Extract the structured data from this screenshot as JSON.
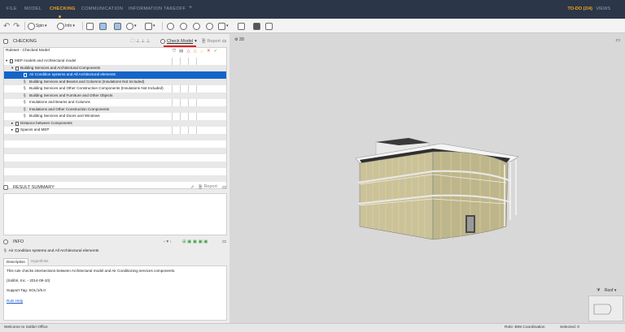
{
  "topbar": {
    "tabs": [
      "FILE",
      "MODEL",
      "CHECKING",
      "COMMUNICATION",
      "INFORMATION TAKEOFF"
    ],
    "active_tab": "CHECKING",
    "todo": "TO-DO (2/4)",
    "views": "VIEWS"
  },
  "toolbar": {
    "spin_label": "Spin",
    "info_label": "Info",
    "search_placeholder": "Search"
  },
  "checking": {
    "title": "CHECKING",
    "check_model_label": "Check Model",
    "report_label": "Report",
    "ruleset": "Ruleset - Checked Model",
    "tree": [
      {
        "label": "MEP models and Architectural model",
        "level": 0
      },
      {
        "label": "Building Services and Architectural Components",
        "level": 1
      },
      {
        "label": "Air Condition systems and All Architectural elements",
        "level": 2
      },
      {
        "label": "Building Services and Beams and Columns (Insulations Not Included)",
        "level": 2
      },
      {
        "label": "Building Services and Other Construction Components (Insulations Not Included)",
        "level": 2
      },
      {
        "label": "Building Services and Furniture and Other Objects",
        "level": 2
      },
      {
        "label": "Insulations and Beams and Columns",
        "level": 2
      },
      {
        "label": "Insulations and Other Construction Components",
        "level": 2
      },
      {
        "label": "Building Services and Doors and Windows",
        "level": 2
      },
      {
        "label": "Distance between Components",
        "level": 1
      },
      {
        "label": "Spaces and MEP",
        "level": 1
      }
    ]
  },
  "result_summary": {
    "title": "RESULT SUMMARY",
    "report_label": "Report"
  },
  "info": {
    "title": "INFO",
    "rule_name": "Air Condition systems and All Architectural elements",
    "tabs": [
      "Description",
      "Hyperlinks"
    ],
    "description": "This rule checks intersections between Architectural model and Air Conditioning services components.",
    "vendor": "(Solibri, Inc. - 2014-09-10)",
    "support_tag": "Support Tag: SOL/1/5.0",
    "rule_help": "Rule Help"
  },
  "viewport": {
    "label": "3D",
    "minimap_label": "Roof"
  },
  "status": {
    "welcome": "Welcome to Solibri Office",
    "role": "Role: BIM Coordination",
    "selected": "Selected: 0"
  }
}
